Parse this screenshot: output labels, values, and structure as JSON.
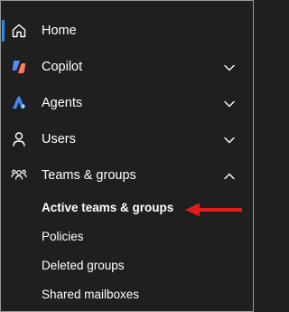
{
  "nav": {
    "items": [
      {
        "label": "Home",
        "icon": "home-icon"
      },
      {
        "label": "Copilot",
        "icon": "copilot-icon",
        "expanded": false
      },
      {
        "label": "Agents",
        "icon": "agents-icon",
        "expanded": false
      },
      {
        "label": "Users",
        "icon": "user-icon",
        "expanded": false
      },
      {
        "label": "Teams & groups",
        "icon": "teams-groups-icon",
        "expanded": true
      }
    ],
    "sub_items": [
      {
        "label": "Active teams & groups",
        "selected": true
      },
      {
        "label": "Policies"
      },
      {
        "label": "Deleted groups"
      },
      {
        "label": "Shared mailboxes"
      }
    ]
  },
  "colors": {
    "background": "#1f1f1f",
    "text": "#ffffff",
    "active_indicator": "#2f8fe8",
    "annotation_arrow": "#e21b1b"
  }
}
